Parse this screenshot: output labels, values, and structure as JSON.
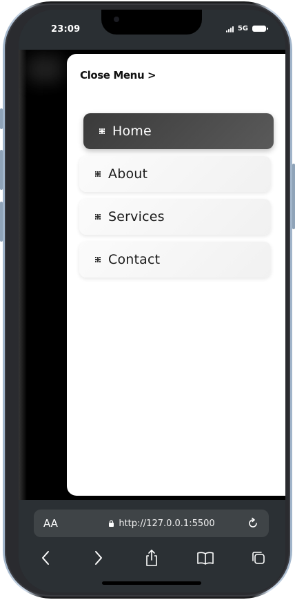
{
  "status_bar": {
    "time": "23:09",
    "network": "5G"
  },
  "menu": {
    "close_label": "Close Menu >",
    "items": [
      {
        "label": "Home",
        "active": true
      },
      {
        "label": "About",
        "active": false
      },
      {
        "label": "Services",
        "active": false
      },
      {
        "label": "Contact",
        "active": false
      }
    ]
  },
  "browser": {
    "aa_label": "AA",
    "url": "http://127.0.0.1:5500"
  },
  "colors": {
    "active_item_bg": "#3a3a3a",
    "panel_bg": "#ffffff",
    "browser_bar_bg": "#2b3034"
  }
}
